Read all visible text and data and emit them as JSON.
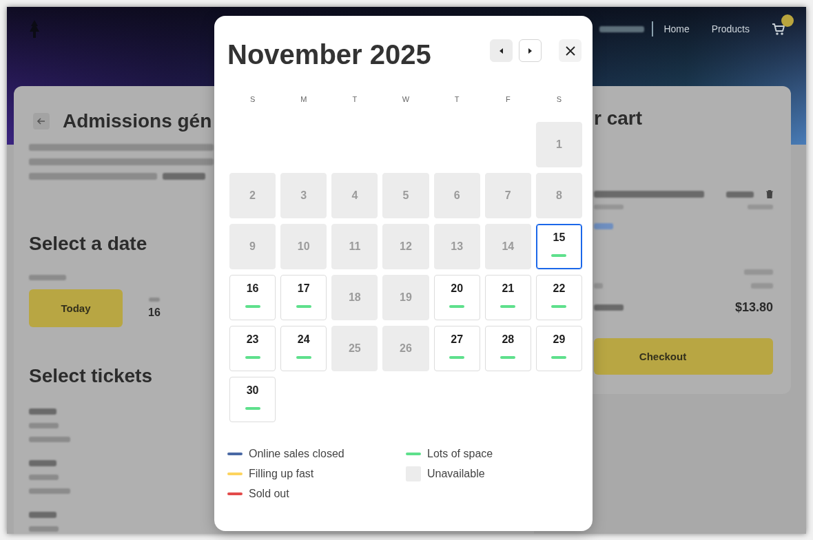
{
  "backdrop": {
    "nav_links": [
      "Home",
      "Products"
    ],
    "page_title": "Admissions gén",
    "date_section": {
      "heading": "Select a date",
      "today_button": "Today",
      "date_option": "16"
    },
    "tickets_heading": "Select tickets",
    "cart": {
      "heading": "r cart",
      "total": "$13.80",
      "checkout_button": "Checkout"
    }
  },
  "calendar": {
    "title": "November 2025",
    "nav_buttons": [
      {
        "kind": "prev",
        "disabled": true
      },
      {
        "kind": "next",
        "disabled": false
      }
    ],
    "weekdays": [
      "S",
      "M",
      "T",
      "W",
      "T",
      "F",
      "S"
    ],
    "weeks": [
      [
        {
          "label": "1",
          "kind": "unavailable",
          "selected": false
        }
      ],
      [
        {
          "label": "2",
          "kind": "unavailable",
          "selected": false
        },
        {
          "label": "3",
          "kind": "unavailable",
          "selected": false
        },
        {
          "label": "4",
          "kind": "unavailable",
          "selected": false
        },
        {
          "label": "5",
          "kind": "unavailable",
          "selected": false
        },
        {
          "label": "6",
          "kind": "unavailable",
          "selected": false
        },
        {
          "label": "7",
          "kind": "unavailable",
          "selected": false
        },
        {
          "label": "8",
          "kind": "unavailable",
          "selected": false
        }
      ],
      [
        {
          "label": "9",
          "kind": "unavailable",
          "selected": false
        },
        {
          "label": "10",
          "kind": "unavailable",
          "selected": false
        },
        {
          "label": "11",
          "kind": "unavailable",
          "selected": false
        },
        {
          "label": "12",
          "kind": "unavailable",
          "selected": false
        },
        {
          "label": "13",
          "kind": "unavailable",
          "selected": false
        },
        {
          "label": "14",
          "kind": "unavailable",
          "selected": false
        },
        {
          "label": "15",
          "kind": "open",
          "color": "#5ee08c",
          "selected": true
        }
      ],
      [
        {
          "label": "16",
          "kind": "open",
          "color": "#5ee08c",
          "selected": false
        },
        {
          "label": "17",
          "kind": "open",
          "color": "#5ee08c",
          "selected": false
        },
        {
          "label": "18",
          "kind": "unavailable",
          "selected": false
        },
        {
          "label": "19",
          "kind": "unavailable",
          "selected": false
        },
        {
          "label": "20",
          "kind": "open",
          "color": "#5ee08c",
          "selected": false
        },
        {
          "label": "21",
          "kind": "open",
          "color": "#5ee08c",
          "selected": false
        },
        {
          "label": "22",
          "kind": "open",
          "color": "#5ee08c",
          "selected": false
        }
      ],
      [
        {
          "label": "23",
          "kind": "open",
          "color": "#5ee08c",
          "selected": false
        },
        {
          "label": "24",
          "kind": "open",
          "color": "#5ee08c",
          "selected": false
        },
        {
          "label": "25",
          "kind": "unavailable",
          "selected": false
        },
        {
          "label": "26",
          "kind": "unavailable",
          "selected": false
        },
        {
          "label": "27",
          "kind": "open",
          "color": "#5ee08c",
          "selected": false
        },
        {
          "label": "28",
          "kind": "open",
          "color": "#5ee08c",
          "selected": false
        },
        {
          "label": "29",
          "kind": "open",
          "color": "#5ee08c",
          "selected": false
        }
      ],
      [
        {
          "label": "30",
          "kind": "open",
          "color": "#5ee08c",
          "selected": false
        }
      ]
    ],
    "legend": [
      {
        "label": "Online sales closed",
        "kind": "line",
        "color": "#4a69a5"
      },
      {
        "label": "Filling up fast",
        "kind": "line",
        "color": "#fdd45e"
      },
      {
        "label": "Sold out",
        "kind": "line",
        "color": "#e34b4b"
      },
      {
        "label": "Lots of space",
        "kind": "line",
        "color": "#5ee08c"
      },
      {
        "label": "Unavailable",
        "kind": "swatch",
        "color": "#ececec"
      }
    ]
  }
}
